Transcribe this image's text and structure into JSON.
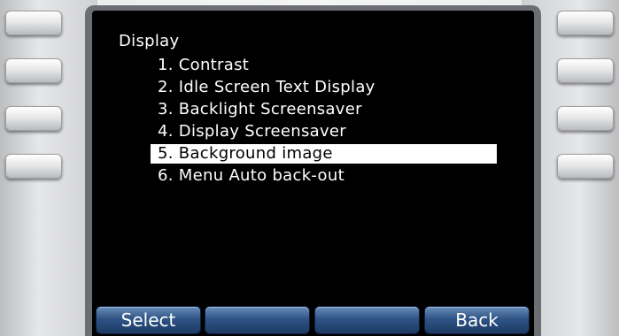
{
  "menu": {
    "title": "Display",
    "items": [
      {
        "label": "1. Contrast"
      },
      {
        "label": "2. Idle Screen Text Display"
      },
      {
        "label": "3. Backlight Screensaver"
      },
      {
        "label": "4. Display Screensaver"
      },
      {
        "label": "5. Background image",
        "selected": true
      },
      {
        "label": "6. Menu Auto back-out"
      }
    ]
  },
  "softbuttons": {
    "btn1": "Select",
    "btn2": "",
    "btn3": "",
    "btn4": "Back"
  },
  "colors": {
    "screen_bg": "#000000",
    "text": "#ffffff",
    "selection_bg": "#ffffff",
    "button_blue": "#2f5486"
  }
}
